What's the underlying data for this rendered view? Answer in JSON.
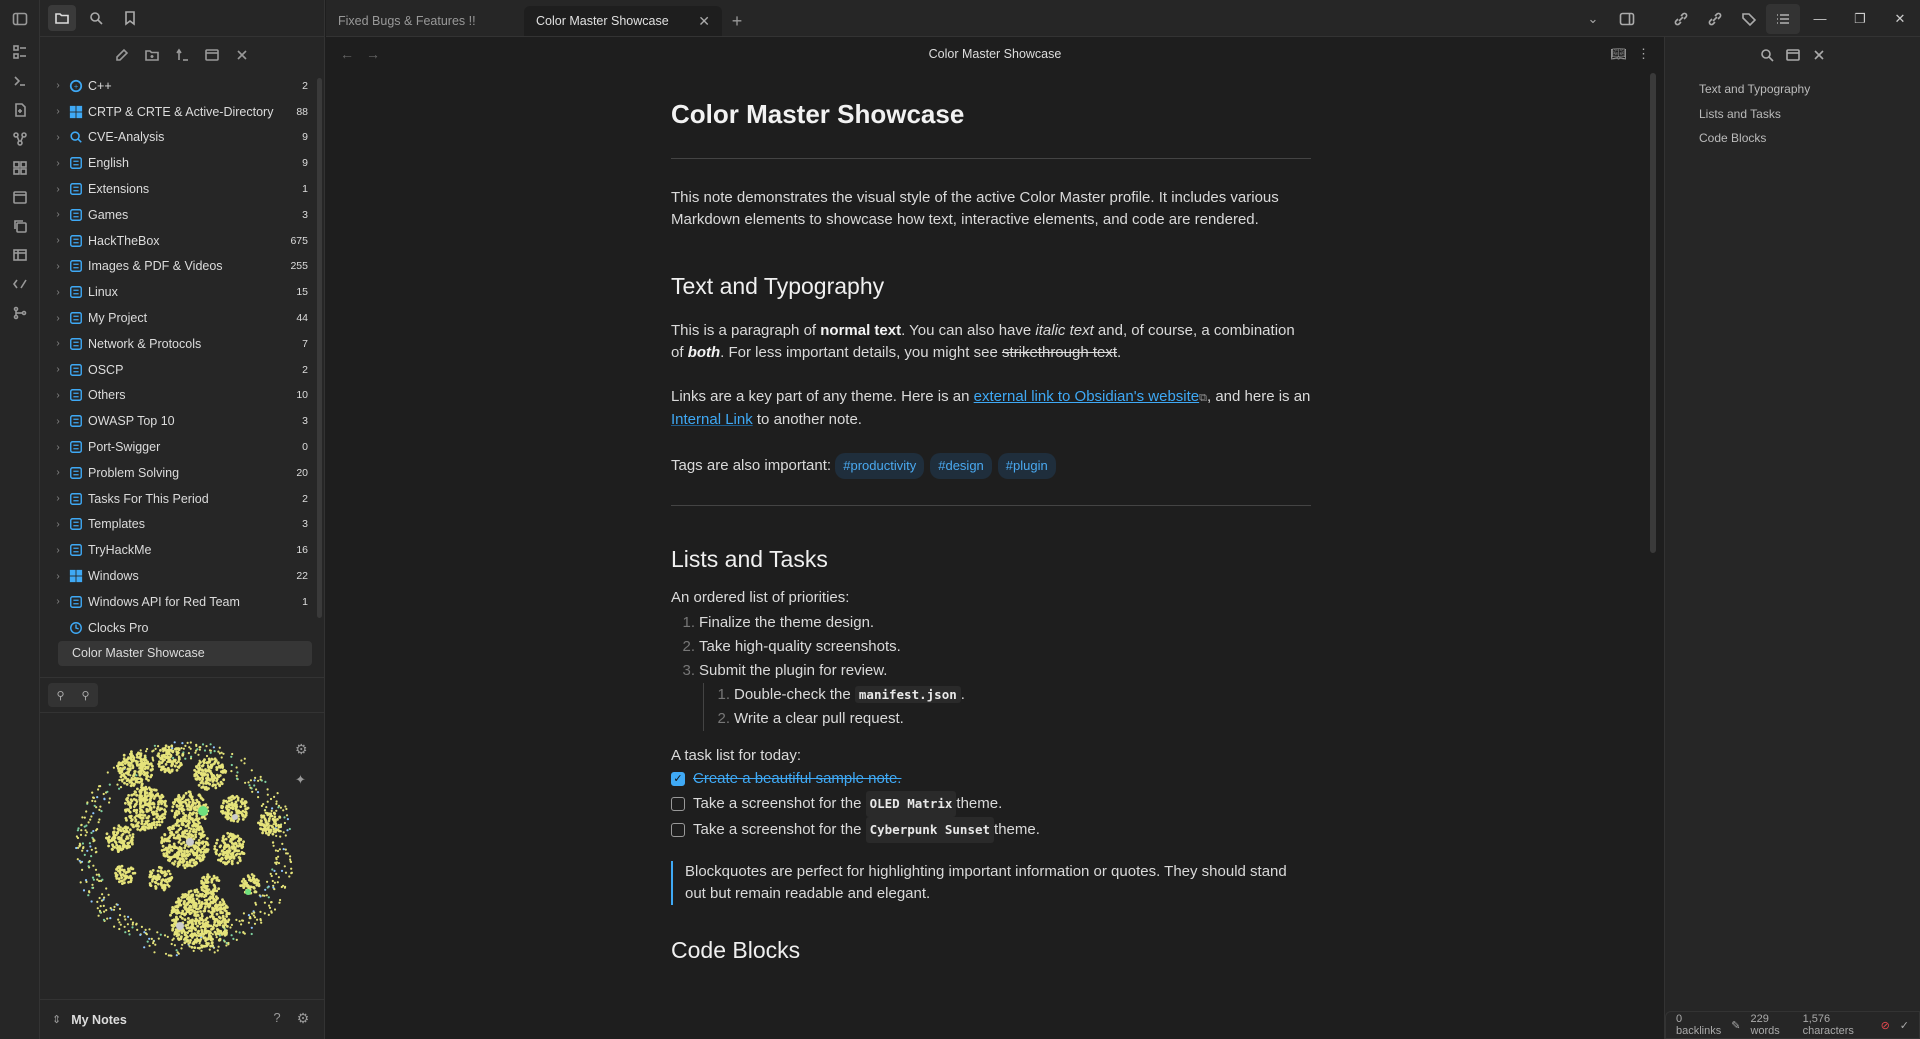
{
  "tabs": [
    {
      "label": "Fixed Bugs & Features !!",
      "active": false
    },
    {
      "label": "Color Master Showcase",
      "active": true
    }
  ],
  "tree": [
    {
      "label": "C++",
      "count": "2",
      "icon": "cpp-icon",
      "color": "#3fa9f5"
    },
    {
      "label": "CRTP  & CRTE & Active-Directory",
      "count": "88",
      "icon": "windows-icon",
      "color": "#3fa9f5"
    },
    {
      "label": "CVE-Analysis",
      "count": "9",
      "icon": "search-icon",
      "color": "#3fa9f5"
    },
    {
      "label": "English",
      "count": "9",
      "icon": "book-icon",
      "color": "#3fa9f5"
    },
    {
      "label": "Extensions",
      "count": "1",
      "icon": "extension-icon",
      "color": "#3fa9f5"
    },
    {
      "label": "Games",
      "count": "3",
      "icon": "gamepad-icon",
      "color": "#3fa9f5"
    },
    {
      "label": "HackTheBox",
      "count": "675",
      "icon": "cube-icon",
      "color": "#3fa9f5"
    },
    {
      "label": "Images & PDF & Videos",
      "count": "255",
      "icon": "images-icon",
      "color": "#3fa9f5"
    },
    {
      "label": "Linux",
      "count": "15",
      "icon": "linux-icon",
      "color": "#3fa9f5"
    },
    {
      "label": "My Project",
      "count": "44",
      "icon": "document-icon",
      "color": "#3fa9f5"
    },
    {
      "label": "Network & Protocols",
      "count": "7",
      "icon": "network-icon",
      "color": "#3fa9f5"
    },
    {
      "label": "OSCP",
      "count": "2",
      "icon": "shield-icon",
      "color": "#3fa9f5"
    },
    {
      "label": "Others",
      "count": "10",
      "icon": "puzzle-icon",
      "color": "#3fa9f5"
    },
    {
      "label": "OWASP Top 10",
      "count": "3",
      "icon": "bug-icon",
      "color": "#3fa9f5"
    },
    {
      "label": "Port-Swigger",
      "count": "0",
      "icon": "swigger-icon",
      "color": "#3fa9f5"
    },
    {
      "label": "Problem Solving",
      "count": "20",
      "icon": "sparkle-icon",
      "color": "#3fa9f5"
    },
    {
      "label": "Tasks For This Period",
      "count": "2",
      "icon": "tasks-icon",
      "color": "#3fa9f5"
    },
    {
      "label": "Templates",
      "count": "3",
      "icon": "template-icon",
      "color": "#3fa9f5"
    },
    {
      "label": "TryHackMe",
      "count": "16",
      "icon": "cloud-icon",
      "color": "#3fa9f5"
    },
    {
      "label": "Windows",
      "count": "22",
      "icon": "windows-icon",
      "color": "#3fa9f5"
    },
    {
      "label": "Windows API for Red Team",
      "count": "1",
      "icon": "api-icon",
      "color": "#3fa9f5"
    }
  ],
  "files": [
    "Clocks Pro",
    "Color Master Showcase"
  ],
  "vault": {
    "name": "My Notes"
  },
  "view": {
    "title": "Color Master Showcase"
  },
  "doc": {
    "h1": "Color Master Showcase",
    "intro": "This note demonstrates the visual style of the active Color Master profile. It includes various Markdown elements to showcase how text, interactive elements, and code are rendered.",
    "h2_text": "Text and Typography",
    "p1_a": "This is a paragraph of ",
    "p1_bold": "normal text",
    "p1_b": ". You can also have ",
    "p1_italic": "italic text",
    "p1_c": " and, of course, a combination of ",
    "p1_bolditalic": "both",
    "p1_d": ". For less important details, you might see ",
    "p1_strike": "strikethrough text",
    "p1_e": ".",
    "p2_a": "Links are a key part of any theme. Here is an ",
    "p2_ext": "external link to Obsidian's website",
    "p2_b": ", and here is an ",
    "p2_int": "Internal Link",
    "p2_c": " to another note.",
    "tags_label": "Tags are also important: ",
    "tags": [
      "#productivity",
      "#design",
      "#plugin"
    ],
    "h2_lists": "Lists and Tasks",
    "ordered_intro": "An ordered list of priorities:",
    "ordered": [
      "Finalize the theme design.",
      "Take high-quality screenshots.",
      "Submit the plugin for review."
    ],
    "sub_1a": "Double-check the ",
    "sub_1code": "manifest.json",
    "sub_1b": ".",
    "sub_2": "Write a clear pull request.",
    "task_intro": "A task list for today:",
    "task1": "Create a beautiful sample note.",
    "task2a": "Take a screenshot for the ",
    "task2code": "OLED Matrix",
    "task2b": " theme.",
    "task3a": "Take a screenshot for the ",
    "task3code": "Cyberpunk Sunset",
    "task3b": " theme.",
    "quote": "Blockquotes are perfect for highlighting important information or quotes. They should stand out but remain readable and elegant.",
    "h2_code": "Code Blocks"
  },
  "outline": [
    "Text and Typography",
    "Lists and Tasks",
    "Code Blocks"
  ],
  "status": {
    "backlinks": "0 backlinks",
    "words": "229 words",
    "chars": "1,576 characters"
  },
  "colors": {
    "accent": "#3fa9f5",
    "bg": "#1e1e1e",
    "panel": "#262626",
    "graph_node": "#e5e37a"
  }
}
